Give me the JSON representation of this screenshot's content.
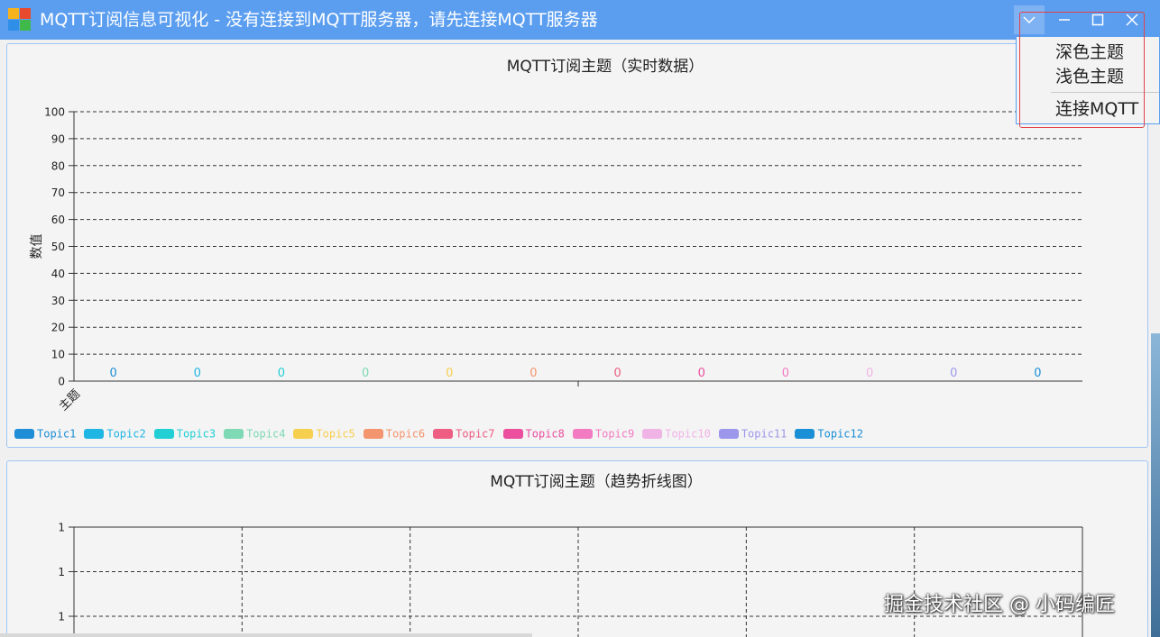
{
  "window": {
    "title": "MQTT订阅信息可视化 - 没有连接到MQTT服务器，请先连接MQTT服务器"
  },
  "menu": {
    "items": [
      {
        "label": "深色主题"
      },
      {
        "label": "浅色主题"
      },
      {
        "label": "连接MQTT"
      }
    ]
  },
  "icons": {
    "app": "app-icon",
    "dropdown": "chevron-down-icon",
    "minimize": "minimize-icon",
    "maximize": "maximize-icon",
    "close": "close-icon"
  },
  "colors": {
    "titlebar": "#5b9ef0",
    "highlight": "#e0424a",
    "panel_border": "#9ec5f3"
  },
  "chart_data": [
    {
      "type": "bar",
      "title": "MQTT订阅主题（实时数据）",
      "xlabel": "主题",
      "ylabel": "数值",
      "ylim": [
        0,
        100
      ],
      "yticks": [
        0,
        10,
        20,
        30,
        40,
        50,
        60,
        70,
        80,
        90,
        100
      ],
      "grid": true,
      "legend_position": "bottom-left",
      "series": [
        {
          "name": "Topic1",
          "values": [
            0
          ],
          "color": "#1f8ed6"
        },
        {
          "name": "Topic2",
          "values": [
            0
          ],
          "color": "#20b6e3"
        },
        {
          "name": "Topic3",
          "values": [
            0
          ],
          "color": "#22cfd4"
        },
        {
          "name": "Topic4",
          "values": [
            0
          ],
          "color": "#7ed9b4"
        },
        {
          "name": "Topic5",
          "values": [
            0
          ],
          "color": "#f6cf4f"
        },
        {
          "name": "Topic6",
          "values": [
            0
          ],
          "color": "#f3956e"
        },
        {
          "name": "Topic7",
          "values": [
            0
          ],
          "color": "#ee5d82"
        },
        {
          "name": "Topic8",
          "values": [
            0
          ],
          "color": "#eb4f9e"
        },
        {
          "name": "Topic9",
          "values": [
            0
          ],
          "color": "#f27bc1"
        },
        {
          "name": "Topic10",
          "values": [
            0
          ],
          "color": "#f0b3e6"
        },
        {
          "name": "Topic11",
          "values": [
            0
          ],
          "color": "#9c97ea"
        },
        {
          "name": "Topic12",
          "values": [
            0
          ],
          "color": "#1b8fd6"
        }
      ]
    },
    {
      "type": "line",
      "title": "MQTT订阅主题（趋势折线图）",
      "ytick_labels": [
        "1",
        "1",
        "1"
      ],
      "grid": true,
      "series": []
    }
  ],
  "watermark": "掘金技术社区 @ 小码编匠"
}
